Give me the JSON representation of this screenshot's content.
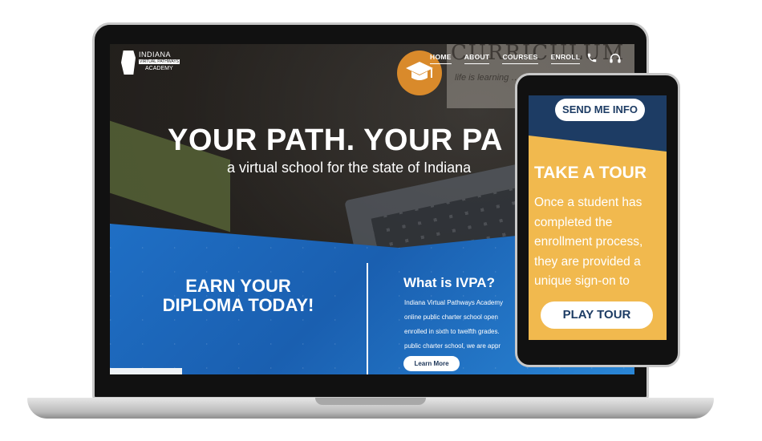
{
  "logo": {
    "line1": "INDIANA",
    "line2": "VIRTUAL PATHWAYS",
    "line3": "ACADEMY"
  },
  "nav": {
    "items": [
      "HOME",
      "ABOUT",
      "COURSES",
      "ENROLL"
    ],
    "icons": [
      "phone-icon",
      "headset-icon"
    ]
  },
  "background": {
    "board_text": "CURRICULUM",
    "board_sub": "life is learning … continuously"
  },
  "hero": {
    "title": "YOUR PATH. YOUR PA",
    "subtitle": "a virtual school for the state of Indiana"
  },
  "earn": {
    "text": "EARN YOUR DIPLOMA TODAY!"
  },
  "what": {
    "title": "What is IVPA?",
    "body": "Indiana Virtual Pathways Academy\nonline public charter school open\nenrolled in sixth to twelfth grades.\npublic charter school, we are appr",
    "button": "Learn More"
  },
  "phone": {
    "send_button": "SEND ME INFO",
    "tour_title": "TAKE A TOUR",
    "tour_body": "Once a student has\ncompleted the\nenrollment process,\nthey are provided a\nunique sign-on to",
    "play_button": "PLAY TOUR"
  },
  "colors": {
    "blue_section": "#1f6fc5",
    "navy": "#1d3c64",
    "yellow": "#f1b94e",
    "cap_orange": "#d98a2b"
  }
}
